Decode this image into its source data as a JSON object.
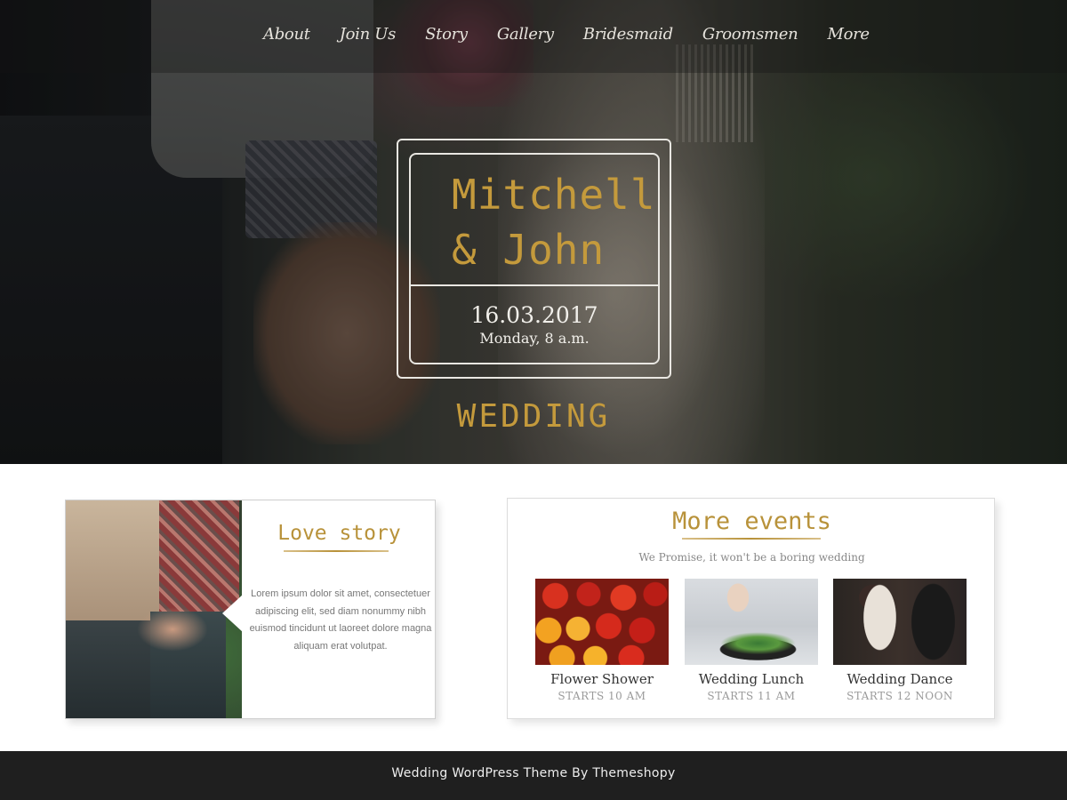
{
  "nav": {
    "items": [
      "About",
      "Join Us",
      "Story",
      "Gallery",
      "Bridesmaid",
      "Groomsmen",
      "More"
    ]
  },
  "hero": {
    "name_line1": "Mitchell",
    "name_line2": "& John",
    "date": "16.03.2017",
    "time": "Monday, 8 a.m.",
    "event_word": "WEDDING"
  },
  "love_story": {
    "title": "Love story",
    "text": "Lorem ipsum dolor sit amet, consectetuer adipiscing elit, sed diam nonummy nibh euismod tincidunt ut laoreet dolore magna aliquam erat volutpat."
  },
  "events": {
    "title": "More events",
    "subtitle": "We Promise, it won't be a boring wedding",
    "items": [
      {
        "name": "Flower Shower",
        "time": "STARTS 10 AM"
      },
      {
        "name": "Wedding Lunch",
        "time": "STARTS 11 AM"
      },
      {
        "name": "Wedding Dance",
        "time": "STARTS 12 NOON"
      }
    ]
  },
  "footer": {
    "text": "Wedding WordPress Theme By Themeshopy"
  },
  "colors": {
    "accent_gold": "#c49a3c",
    "footer_bg": "#1f1f1f"
  }
}
